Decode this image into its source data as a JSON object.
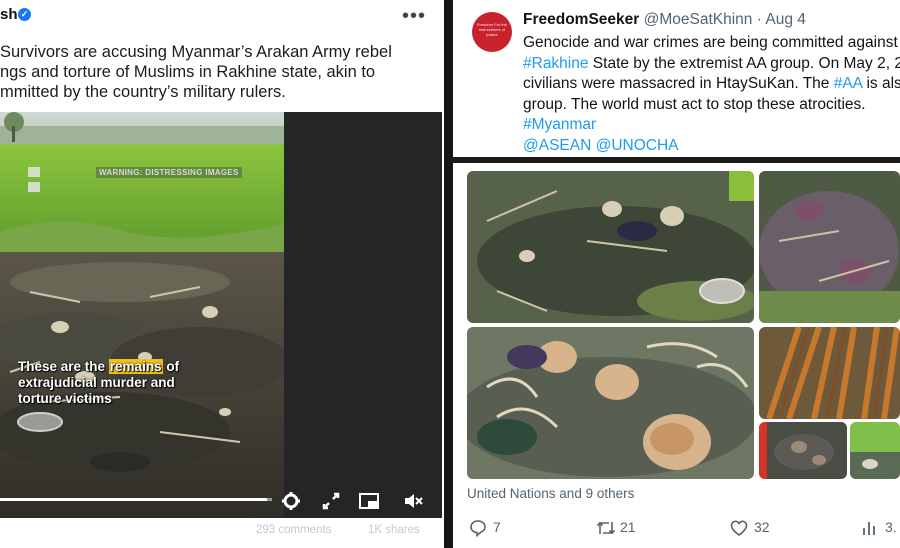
{
  "left_post": {
    "author_fragment": "sh",
    "more_icon": "•••",
    "text_lines": [
      "Survivors are accusing Myanmar’s Arakan Army rebel",
      "ngs and torture of Muslims in Rakhine state, akin to",
      "mmitted by the country’s military rulers."
    ],
    "video": {
      "warning": "WARNING: DISTRESSING IMAGES",
      "caption_line1_before": "These are the ",
      "caption_highlight": "remains",
      "caption_line1_after": " of",
      "caption_line2": "extrajudicial murder and",
      "caption_line3": "torture victims",
      "progress": 0.98
    },
    "footer": {
      "comments": "293 comments",
      "shares": "1K shares"
    }
  },
  "tweet": {
    "display_name": "FreedomSeeker",
    "handle": "@MoeSatKhinn",
    "separator": "·",
    "date": "Aug 4",
    "avatar_text": "Freedom For the real seekers of justice",
    "line1": "Genocide and war crimes are being committed against",
    "line2_tag": "#Rakhine",
    "line2_rest": " State by the extremist AA group. On May 2, 2",
    "line3_before": "civilians were massacred in HtaySuKan. The ",
    "line3_tag": "#AA",
    "line3_after": " is als",
    "line4": "group. The world must act to stop these atrocities.",
    "line5_tag": "#Myanmar",
    "line6_tags": "@ASEAN @UNOCHA",
    "tagged": "United Nations and 9 others",
    "actions": {
      "replies": "7",
      "reposts": "21",
      "likes": "32",
      "views": "3."
    }
  },
  "colors": {
    "link_blue": "#1d9bf0",
    "highlight_yellow": "#f1c21b",
    "avatar_red": "#c8232c",
    "verified_blue": "#1877f2"
  }
}
